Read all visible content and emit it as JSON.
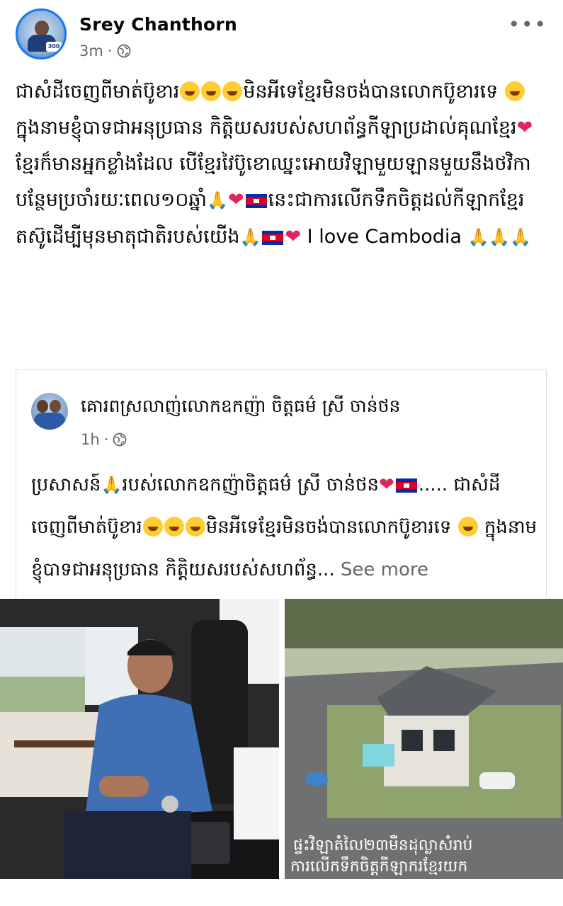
{
  "post": {
    "author": "Srey Chanthorn",
    "time": "3m",
    "more_label": "•••",
    "paragraph1": "ជាសំដីចេញពីមាត់ប៊ូខារ",
    "paragraph1_b": "មិនអីទេខ្មែរមិនចង់បានលោកប៊ូខារទេ",
    "paragraph1_c": "ក្នុងនាមខ្ញុំបាទជាអនុប្រធាន កិត្តិយសរបស់សហព័ន្ធកីឡាប្រដាល់គុណខ្មែរ",
    "paragraph2": "ខ្មែរក៏មានអ្នកខ្លាំងដែល បើខ្មែរវៃប៊ូខោឈ្នះអោយវិឡាមួយឡានមួយនឹងថវិកាបន្ថែមប្រចាំរយៈពេល១០ឆ្នាំ",
    "paragraph2_b": "នេះជាការលើកទឹកចិត្តដល់កីឡាកខ្មែរ តស៊ូដើម្បីមុនមាតុជាតិរបស់យើង",
    "paragraph2_c": "I love Cambodia"
  },
  "shared": {
    "author": "គោរពស្រលាញ់លោកឧកញ៉ា ចិត្តធម៌ ស្រី ចាន់ថន",
    "time": "1h",
    "text_a": "ប្រសាសន៍",
    "text_b": "របស់លោកឧកញ៉ាចិត្តធម៌ ស្រី ចាន់ថន",
    "text_c": "..... ជាសំដីចេញពីមាត់ប៊ូខារ",
    "text_d": "មិនអីទេខ្មែរមិនចង់បានលោកប៊ូខារទេ",
    "text_e": "ក្នុងនាមខ្ញុំបាទជាអនុប្រធាន កិត្តិយសរបស់សហព័ន្ធ...",
    "see_more": "See more"
  },
  "photos": {
    "right_caption_line1": "ផ្ទះវិឡាតំលៃ២៣មឺនដុល្លាសំរាប់",
    "right_caption_line2": "ការលើកទឹកចិត្តកីឡាករខ្មែរយក"
  },
  "colors": {
    "text": "#050505",
    "secondary": "#65676b",
    "accent": "#1877f2",
    "heart": "#e0245e"
  }
}
